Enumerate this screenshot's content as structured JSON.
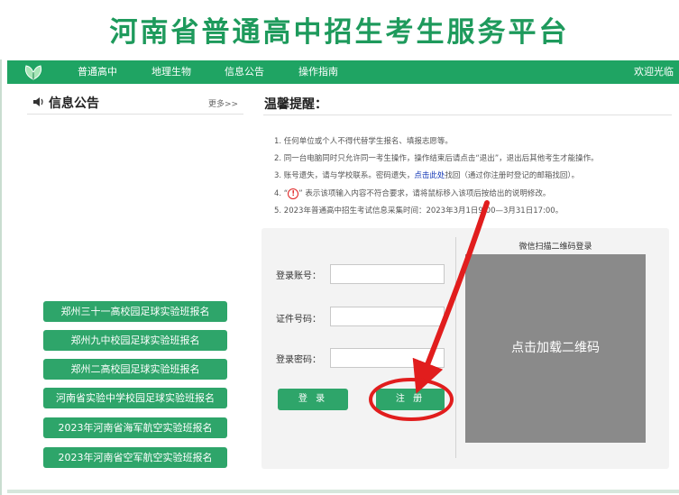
{
  "header": {
    "site_title": "河南省普通高中招生考生服务平台"
  },
  "nav": {
    "items": [
      "普通高中",
      "地理生物",
      "信息公告",
      "操作指南"
    ],
    "welcome": "欢迎光临"
  },
  "notice": {
    "title": "信息公告",
    "more": "更多>>",
    "buttons": [
      "郑州三十一高校园足球实验班报名",
      "郑州九中校园足球实验班报名",
      "郑州二高校园足球实验班报名",
      "河南省实验中学校园足球实验班报名",
      "2023年河南省海军航空实验班报名",
      "2023年河南省空军航空实验班报名"
    ]
  },
  "tips": {
    "title": "温馨提醒：",
    "line1": "1. 任何单位或个人不得代替学生报名、填报志愿等。",
    "line2": "2. 同一台电脑同时只允许同一考生操作，操作结束后请点击“退出”，退出后其他考生才能操作。",
    "line3_before": "3. 账号遗失，请与学校联系。密码遗失，",
    "line3_link": "点击此处",
    "line3_after": "找回（通过你注册时登记的邮箱找回）。",
    "line4_prefix": "4. “",
    "line4_symbol": "!",
    "line4_after": "” 表示该项输入内容不符合要求，请将鼠标移入该项后按给出的说明修改。",
    "line5": "5. 2023年普通高中招生考试信息采集时间：2023年3月1日9:00—3月31日17:00。"
  },
  "login": {
    "account_label": "登录账号：",
    "account_value": "",
    "id_label": "证件号码：",
    "id_value": "",
    "password_label": "登录密码：",
    "password_value": "",
    "login_button": "登 录",
    "register_button": "注 册"
  },
  "qr": {
    "title": "微信扫描二维码登录",
    "load_label": "点击加载二维码"
  },
  "colors": {
    "brand_green": "#1fa463",
    "button_green": "#2ea56a",
    "annotation_red": "#e11d1d",
    "qr_gray": "#8a8a8a"
  },
  "icons": [
    "leaf-logo-icon",
    "speaker-icon",
    "warning-circle-icon",
    "red-arrow-annotation"
  ]
}
